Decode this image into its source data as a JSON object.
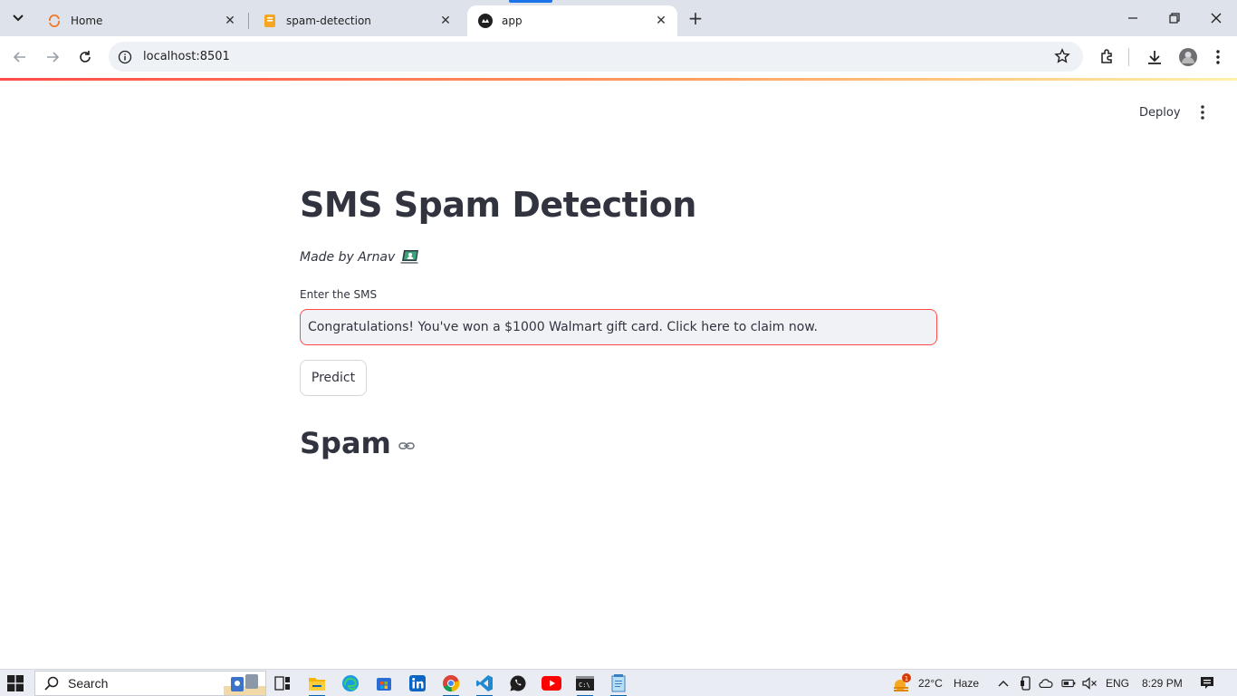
{
  "browser": {
    "tabs": [
      {
        "title": "Home",
        "icon": "jupyter-icon",
        "active": false
      },
      {
        "title": "spam-detection",
        "icon": "notebook-icon",
        "active": false
      },
      {
        "title": "app",
        "icon": "streamlit-icon",
        "active": true
      }
    ],
    "address": "localhost:8501",
    "accent": "#1a73e8"
  },
  "app": {
    "header": {
      "deploy_label": "Deploy"
    },
    "title": "SMS Spam Detection",
    "caption": "Made by Arnav",
    "input": {
      "label": "Enter the SMS",
      "value": "Congratulations! You've won a $1000 Walmart gift card. Click here to claim now."
    },
    "predict_label": "Predict",
    "result": "Spam",
    "colors": {
      "primary": "#ff4b4b",
      "text": "#31333f",
      "input_bg": "#f0f2f6"
    }
  },
  "taskbar": {
    "search_label": "Search",
    "apps": [
      "widgets-icon",
      "task-view-icon",
      "file-explorer-icon",
      "edge-icon",
      "store-icon",
      "linkedin-icon",
      "chrome-icon",
      "vscode-icon",
      "whatsapp-icon",
      "youtube-icon",
      "terminal-icon",
      "notepad-icon"
    ],
    "weather": {
      "temp": "22°C",
      "condition": "Haze",
      "badge": "1"
    },
    "language": "ENG",
    "time": "8:29 PM"
  }
}
